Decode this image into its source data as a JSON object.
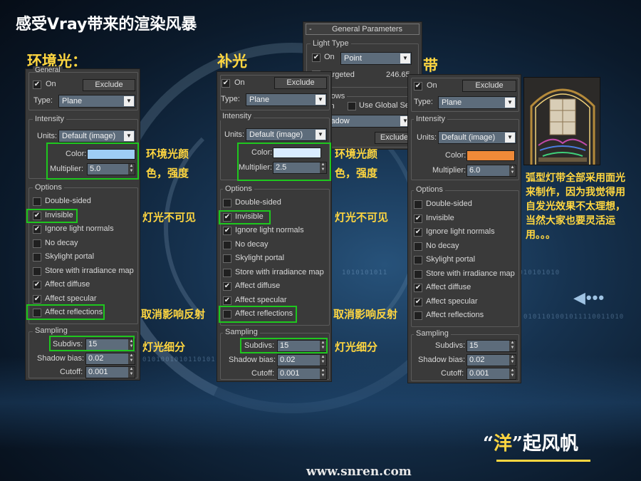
{
  "slide": {
    "title": "感受Vray带来的渲染风暴",
    "heads": {
      "ambient": "环境光：",
      "fill": "补光",
      "strip": "带"
    },
    "logo_quote_open": "“",
    "logo_quote_close": "”",
    "logo_char": "洋",
    "logo_rest": "起风帆",
    "url": "www.snren.com",
    "note": "弧型灯带全部采用面光来制作，因为我觉得用自发光效果不太理想，当然大家也要灵活运用。。。",
    "arrow": "◀•••"
  },
  "annotations": {
    "color_strength_line1": "环境光颜",
    "color_strength_line2": "色，强度",
    "invisible": "灯光不可见",
    "cancel_reflections": "取消影响反射",
    "subdivs": "灯光细分"
  },
  "colors": {
    "accent": "#ffd640",
    "highlight": "#1ec71e",
    "panel": "#3a3a3a"
  },
  "general_params": {
    "title": "General Parameters",
    "collapse": "-",
    "light_type_label": "Light Type",
    "on_label": "On",
    "type_value": "Point",
    "targeted_label": "Targeted",
    "targeted_value": "246.65",
    "shadows_label": "Shadows",
    "shadows_on": "On",
    "use_global": "Use Global Settin",
    "shadow_type": "Shadow",
    "exclude": "Exclude"
  },
  "panels": [
    {
      "id": "left",
      "top_label": "General",
      "on_label": "On",
      "exclude": "Exclude",
      "type_label": "Type:",
      "type_value": "Plane",
      "intensity_label": "Intensity",
      "units_label": "Units:",
      "units_value": "Default (image)",
      "color_label": "Color:",
      "color_hex": "#9ecdf4",
      "multiplier_label": "Multiplier:",
      "multiplier_value": "5.0",
      "options_label": "Options",
      "options": [
        {
          "label": "Double-sided",
          "checked": false
        },
        {
          "label": "Invisible",
          "checked": true
        },
        {
          "label": "Ignore light normals",
          "checked": true
        },
        {
          "label": "No decay",
          "checked": false
        },
        {
          "label": "Skylight portal",
          "checked": false
        },
        {
          "label": "Store with irradiance map",
          "checked": false
        },
        {
          "label": "Affect diffuse",
          "checked": true
        },
        {
          "label": "Affect specular",
          "checked": true
        },
        {
          "label": "Affect reflections",
          "checked": false
        }
      ],
      "sampling_label": "Sampling",
      "subdivs_label": "Subdivs:",
      "subdivs_value": "15",
      "shadow_bias_label": "Shadow bias:",
      "shadow_bias_value": "0.02",
      "cutoff_label": "Cutoff:",
      "cutoff_value": "0.001"
    },
    {
      "id": "middle",
      "top_label": "",
      "on_label": "On",
      "exclude": "Exclude",
      "type_label": "Type:",
      "type_value": "Plane",
      "intensity_label": "Intensity",
      "units_label": "Units:",
      "units_value": "Default (image)",
      "color_label": "Color:",
      "color_hex": "#d9ecff",
      "multiplier_label": "Multiplier:",
      "multiplier_value": "2.5",
      "options_label": "Options",
      "options": [
        {
          "label": "Double-sided",
          "checked": false
        },
        {
          "label": "Invisible",
          "checked": true
        },
        {
          "label": "Ignore light normals",
          "checked": true
        },
        {
          "label": "No decay",
          "checked": false
        },
        {
          "label": "Skylight portal",
          "checked": false
        },
        {
          "label": "Store with irradiance map",
          "checked": false
        },
        {
          "label": "Affect diffuse",
          "checked": true
        },
        {
          "label": "Affect specular",
          "checked": true
        },
        {
          "label": "Affect reflections",
          "checked": false
        }
      ],
      "sampling_label": "Sampling",
      "subdivs_label": "Subdivs:",
      "subdivs_value": "15",
      "shadow_bias_label": "Shadow bias:",
      "shadow_bias_value": "0.02",
      "cutoff_label": "Cutoff:",
      "cutoff_value": "0.001"
    },
    {
      "id": "right",
      "top_label": "",
      "on_label": "On",
      "exclude": "Exclude",
      "type_label": "Type:",
      "type_value": "Plane",
      "intensity_label": "Intensity",
      "units_label": "Units:",
      "units_value": "Default (image)",
      "color_label": "Color:",
      "color_hex": "#f08a38",
      "multiplier_label": "Multiplier:",
      "multiplier_value": "6.0",
      "options_label": "Options",
      "options": [
        {
          "label": "Double-sided",
          "checked": false
        },
        {
          "label": "Invisible",
          "checked": true
        },
        {
          "label": "Ignore light normals",
          "checked": true
        },
        {
          "label": "No decay",
          "checked": false
        },
        {
          "label": "Skylight portal",
          "checked": false
        },
        {
          "label": "Store with irradiance map",
          "checked": false
        },
        {
          "label": "Affect diffuse",
          "checked": true
        },
        {
          "label": "Affect specular",
          "checked": true
        },
        {
          "label": "Affect reflections",
          "checked": false
        }
      ],
      "sampling_label": "Sampling",
      "subdivs_label": "Subdivs:",
      "subdivs_value": "15",
      "shadow_bias_label": "Shadow bias:",
      "shadow_bias_value": "0.02",
      "cutoff_label": "Cutoff:",
      "cutoff_value": "0.001"
    }
  ]
}
